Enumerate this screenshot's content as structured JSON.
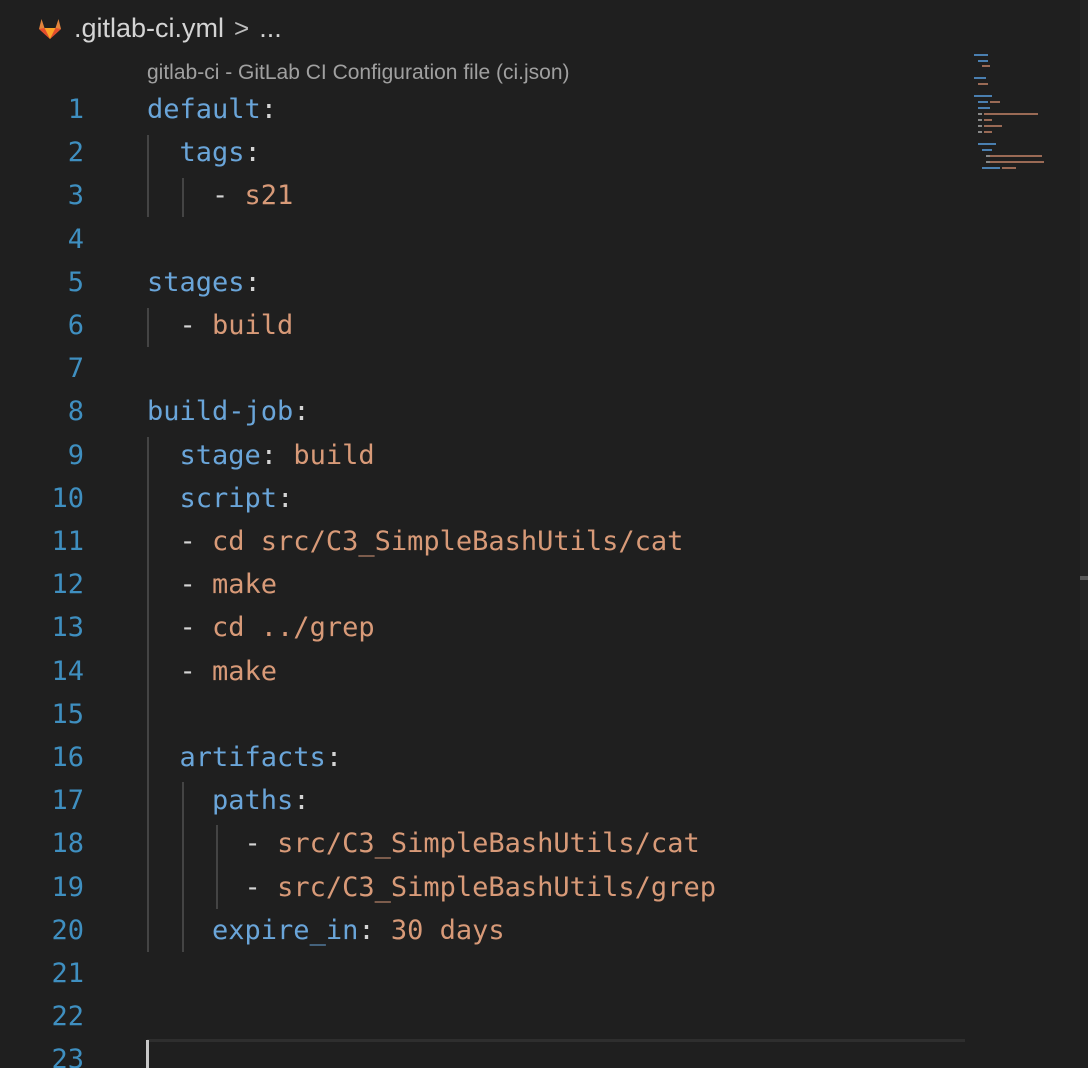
{
  "breadcrumb": {
    "icon": "gitlab-icon",
    "file": ".gitlab-ci.yml",
    "separator": ">",
    "more": "..."
  },
  "codelens": "gitlab-ci - GitLab CI Configuration file (ci.json)",
  "colors": {
    "background": "#1f1f1f",
    "line_number": "#3f8fc0",
    "key": "#6aa5d9",
    "value": "#d89a78",
    "punctuation": "#d4d4d4",
    "gitlab_orange": "#e2843c"
  },
  "lines": [
    {
      "n": "1",
      "indent": "",
      "key": "default",
      "sep": ":",
      "dash": "",
      "value": ""
    },
    {
      "n": "2",
      "indent": "  ",
      "key": "tags",
      "sep": ":",
      "dash": "",
      "value": ""
    },
    {
      "n": "3",
      "indent": "    ",
      "key": "",
      "sep": "",
      "dash": "- ",
      "value": "s21"
    },
    {
      "n": "4",
      "indent": "",
      "key": "",
      "sep": "",
      "dash": "",
      "value": ""
    },
    {
      "n": "5",
      "indent": "",
      "key": "stages",
      "sep": ":",
      "dash": "",
      "value": ""
    },
    {
      "n": "6",
      "indent": "  ",
      "key": "",
      "sep": "",
      "dash": "- ",
      "value": "build"
    },
    {
      "n": "7",
      "indent": "",
      "key": "",
      "sep": "",
      "dash": "",
      "value": ""
    },
    {
      "n": "8",
      "indent": "",
      "key": "build-job",
      "sep": ":",
      "dash": "",
      "value": ""
    },
    {
      "n": "9",
      "indent": "  ",
      "key": "stage",
      "sep": ": ",
      "dash": "",
      "value": "build"
    },
    {
      "n": "10",
      "indent": "  ",
      "key": "script",
      "sep": ":",
      "dash": "",
      "value": ""
    },
    {
      "n": "11",
      "indent": "  ",
      "key": "",
      "sep": "",
      "dash": "- ",
      "value": "cd src/C3_SimpleBashUtils/cat"
    },
    {
      "n": "12",
      "indent": "  ",
      "key": "",
      "sep": "",
      "dash": "- ",
      "value": "make"
    },
    {
      "n": "13",
      "indent": "  ",
      "key": "",
      "sep": "",
      "dash": "- ",
      "value": "cd ../grep"
    },
    {
      "n": "14",
      "indent": "  ",
      "key": "",
      "sep": "",
      "dash": "- ",
      "value": "make"
    },
    {
      "n": "15",
      "indent": "",
      "key": "",
      "sep": "",
      "dash": "",
      "value": ""
    },
    {
      "n": "16",
      "indent": "  ",
      "key": "artifacts",
      "sep": ":",
      "dash": "",
      "value": ""
    },
    {
      "n": "17",
      "indent": "    ",
      "key": "paths",
      "sep": ":",
      "dash": "",
      "value": ""
    },
    {
      "n": "18",
      "indent": "      ",
      "key": "",
      "sep": "",
      "dash": "- ",
      "value": "src/C3_SimpleBashUtils/cat"
    },
    {
      "n": "19",
      "indent": "      ",
      "key": "",
      "sep": "",
      "dash": "- ",
      "value": "src/C3_SimpleBashUtils/grep"
    },
    {
      "n": "20",
      "indent": "    ",
      "key": "expire_in",
      "sep": ": ",
      "dash": "",
      "value": "30 days"
    },
    {
      "n": "21",
      "indent": "",
      "key": "",
      "sep": "",
      "dash": "",
      "value": ""
    },
    {
      "n": "22",
      "indent": "",
      "key": "",
      "sep": "",
      "dash": "",
      "value": ""
    },
    {
      "n": "23",
      "indent": "",
      "key": "",
      "sep": "",
      "dash": "",
      "value": ""
    }
  ]
}
